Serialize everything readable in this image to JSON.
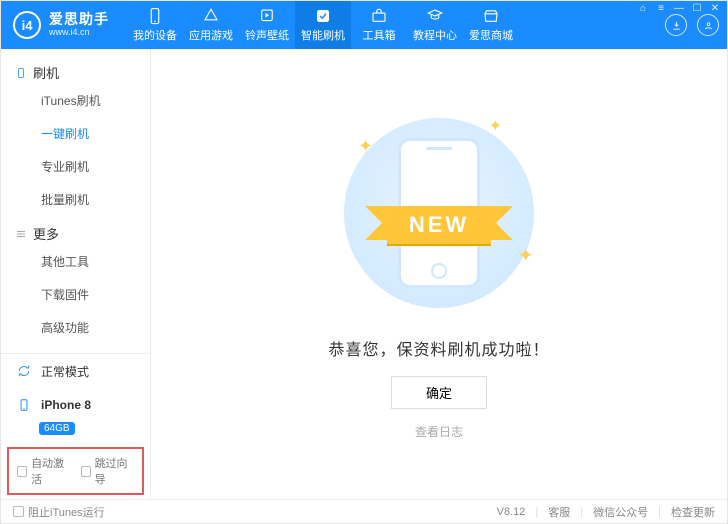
{
  "brand": {
    "title": "爱思助手",
    "sub": "www.i4.cn",
    "logo_text": "i4"
  },
  "header": {
    "tabs": [
      {
        "label": "我的设备"
      },
      {
        "label": "应用游戏"
      },
      {
        "label": "铃声壁纸"
      },
      {
        "label": "智能刷机"
      },
      {
        "label": "工具箱"
      },
      {
        "label": "教程中心"
      },
      {
        "label": "爱思商城"
      }
    ]
  },
  "win": {
    "settings": "⌂",
    "menu": "≡",
    "min": "—",
    "max": "☐",
    "close": "✕"
  },
  "sidebar": {
    "group1": {
      "title": "刷机",
      "items": [
        "iTunes刷机",
        "一键刷机",
        "专业刷机",
        "批量刷机"
      ]
    },
    "group2": {
      "title": "更多",
      "items": [
        "其他工具",
        "下载固件",
        "高级功能"
      ]
    },
    "mode": "正常模式",
    "device": {
      "name": "iPhone 8",
      "storage": "64GB"
    },
    "checks": {
      "auto_activate": "自动激活",
      "skip_guide": "跳过向导"
    }
  },
  "main": {
    "ribbon": "NEW",
    "success": "恭喜您，保资料刷机成功啦！",
    "ok": "确定",
    "log": "查看日志"
  },
  "footer": {
    "block_itunes": "阻止iTunes运行",
    "version": "V8.12",
    "support": "客服",
    "wechat": "微信公众号",
    "update": "检查更新"
  }
}
